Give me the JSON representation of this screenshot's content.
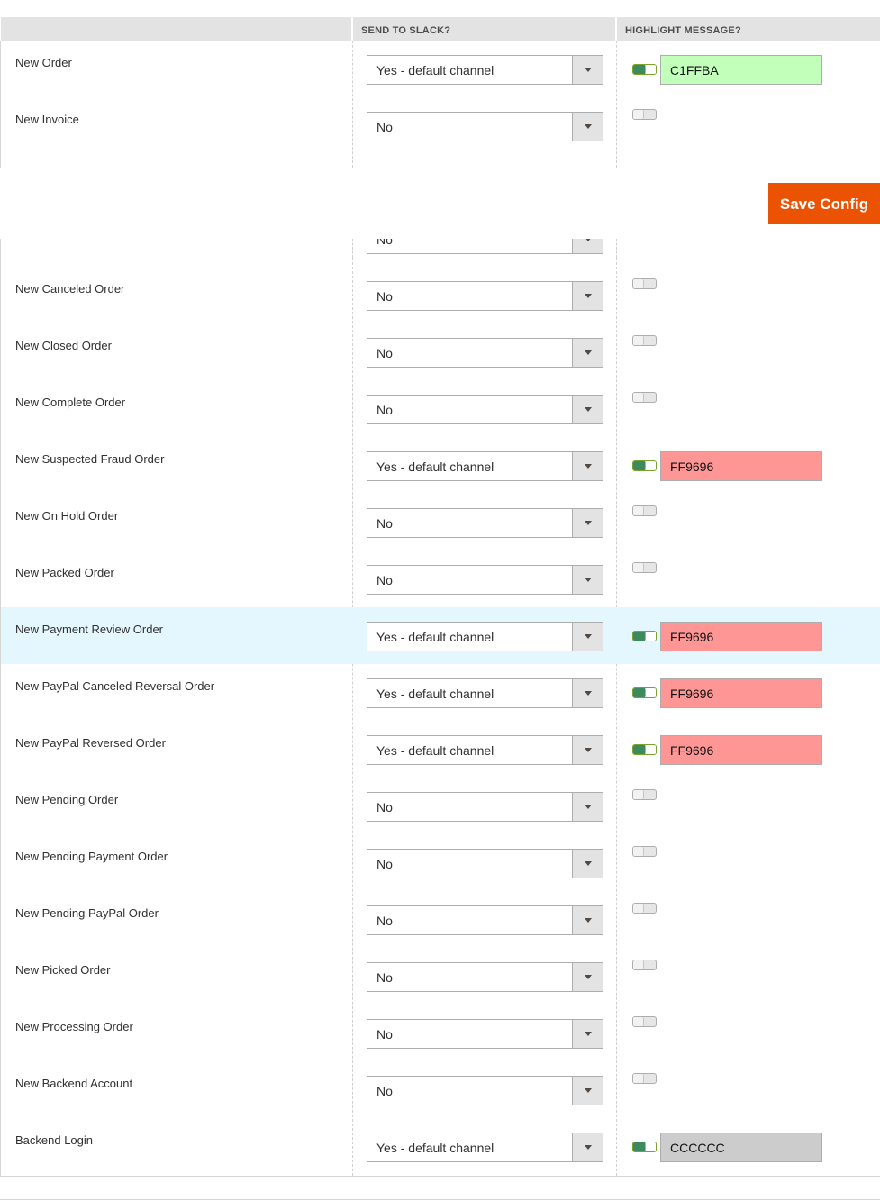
{
  "header": {
    "col_send": "SEND TO SLACK?",
    "col_highlight": "HIGHLIGHT MESSAGE?"
  },
  "rows_top": [
    {
      "label": "New Order",
      "send": "Yes - default channel",
      "highlight": true,
      "color": "C1FFBA",
      "color_hex": "#c1ffba"
    },
    {
      "label": "New Invoice",
      "send": "No",
      "highlight": false
    }
  ],
  "partial_row": {
    "send": "No"
  },
  "save_button": {
    "label": "Save Config"
  },
  "rows_bottom": [
    {
      "label": "New Canceled Order",
      "send": "No",
      "highlight": false
    },
    {
      "label": "New Closed Order",
      "send": "No",
      "highlight": false
    },
    {
      "label": "New Complete Order",
      "send": "No",
      "highlight": false
    },
    {
      "label": "New Suspected Fraud Order",
      "send": "Yes - default channel",
      "highlight": true,
      "color": "FF9696",
      "color_hex": "#ff9696"
    },
    {
      "label": "New On Hold Order",
      "send": "No",
      "highlight": false
    },
    {
      "label": "New Packed Order",
      "send": "No",
      "highlight": false
    },
    {
      "label": "New Payment Review Order",
      "send": "Yes - default channel",
      "highlight": true,
      "color": "FF9696",
      "color_hex": "#ff9696"
    },
    {
      "label": "New PayPal Canceled Reversal Order",
      "send": "Yes - default channel",
      "highlight": true,
      "color": "FF9696",
      "color_hex": "#ff9696"
    },
    {
      "label": "New PayPal Reversed Order",
      "send": "Yes - default channel",
      "highlight": true,
      "color": "FF9696",
      "color_hex": "#ff9696"
    },
    {
      "label": "New Pending Order",
      "send": "No",
      "highlight": false
    },
    {
      "label": "New Pending Payment Order",
      "send": "No",
      "highlight": false
    },
    {
      "label": "New Pending PayPal Order",
      "send": "No",
      "highlight": false
    },
    {
      "label": "New Picked Order",
      "send": "No",
      "highlight": false
    },
    {
      "label": "New Processing Order",
      "send": "No",
      "highlight": false
    },
    {
      "label": "New Backend Account",
      "send": "No",
      "highlight": false
    },
    {
      "label": "Backend Login",
      "send": "Yes - default channel",
      "highlight": true,
      "color": "CCCCCC",
      "color_hex": "#cccccc"
    }
  ],
  "hover_row_label": "New Payment Review Order",
  "colors": {
    "accent": "#eb5202",
    "toggle_on": "#3e8a5f",
    "row_hover": "#e5f7fe"
  }
}
